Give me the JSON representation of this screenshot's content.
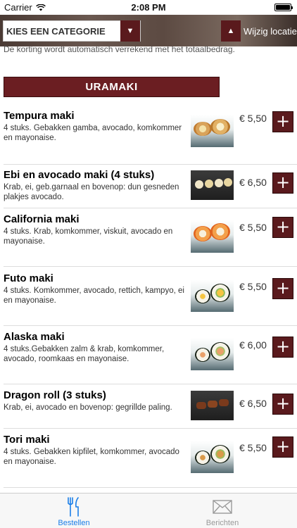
{
  "status_bar": {
    "carrier": "Carrier",
    "time": "2:08 PM"
  },
  "header": {
    "category_placeholder": "KIES EEN CATEGORIE",
    "location_label": "Wijzig locatie"
  },
  "notice": "De korting wordt automatisch verrekend met het totaalbedrag.",
  "section": {
    "title": "URAMAKI"
  },
  "products": [
    {
      "name": "Tempura maki",
      "description": "4 stuks. Gebakken gamba, avocado, komkommer en mayonaise.",
      "price": "€ 5,50",
      "add_label": "+",
      "image": "tempura-maki-photo"
    },
    {
      "name": "Ebi en avocado maki (4 stuks)",
      "description": "Krab, ei, geb.garnaal en bovenop: dun gesneden plakjes avocado.",
      "price": "€ 6,50",
      "add_label": "+",
      "image": "ebi-avocado-maki-photo"
    },
    {
      "name": "California maki",
      "description": "4 stuks. Krab, komkommer, viskuit, avocado en mayonaise.",
      "price": "€ 5,50",
      "add_label": "+",
      "image": "california-maki-photo"
    },
    {
      "name": "Futo maki",
      "description": "4 stuks. Komkommer, avocado, rettich, kampyo, ei en mayonaise.",
      "price": "€ 5,50",
      "add_label": "+",
      "image": "futo-maki-photo"
    },
    {
      "name": "Alaska maki",
      "description": "4 stuks.Gebakken zalm & krab, komkommer, avocado, roomkaas en mayonaise.",
      "price": "€ 6,00",
      "add_label": "+",
      "image": "alaska-maki-photo"
    },
    {
      "name": "Dragon roll (3 stuks)",
      "description": "Krab, ei, avocado en bovenop: gegrillde paling.",
      "price": "€ 6,50",
      "add_label": "+",
      "image": "dragon-roll-photo"
    },
    {
      "name": "Tori maki",
      "description": "4 stuks. Gebakken kipfilet, komkommer, avocado en mayonaise.",
      "price": "€ 5,50",
      "add_label": "+",
      "image": "tori-maki-photo"
    }
  ],
  "tabs": [
    {
      "label": "Bestellen",
      "icon": "fork-knife-icon",
      "active": true
    },
    {
      "label": "Berichten",
      "icon": "envelope-icon",
      "active": false
    }
  ],
  "colors": {
    "accent": "#5a1a1d",
    "section_bg": "#6b1e22",
    "tab_active": "#1a7ee8"
  }
}
